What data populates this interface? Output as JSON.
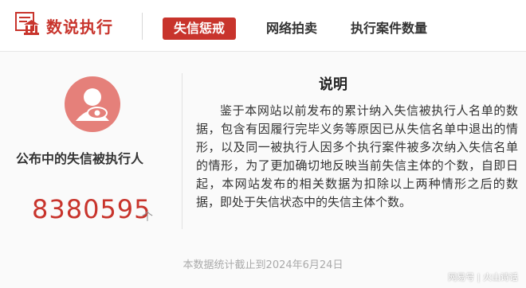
{
  "header": {
    "app_name": "数说执行",
    "tabs": [
      {
        "label": "失信惩戒",
        "active": true
      },
      {
        "label": "网络拍卖",
        "active": false
      },
      {
        "label": "执行案件数量",
        "active": false
      }
    ]
  },
  "left": {
    "label": "公布中的失信被执行人",
    "count": "8380595",
    "unit": "个"
  },
  "right": {
    "title": "说明",
    "text": "鉴于本网站以前发布的累计纳入失信被执行人名单的数据，包含有因履行完毕义务等原因已从失信名单中退出的情形，以及同一被执行人因多个执行案件被多次纳入失信名单的情形，为了更加确切地反映当前失信主体的个数，自即日起，本网站发布的相关数据为扣除以上两种情形之后的数据，即处于失信状态中的失信主体个数。"
  },
  "footer": {
    "note": "本数据统计截止到2024年6月24日"
  },
  "watermark": "网易号 | 火山诗话",
  "colors": {
    "brand_red": "#c8342c",
    "avatar_bg": "#e5807a"
  },
  "icons": [
    "court-building-icon",
    "user-eye-icon"
  ]
}
